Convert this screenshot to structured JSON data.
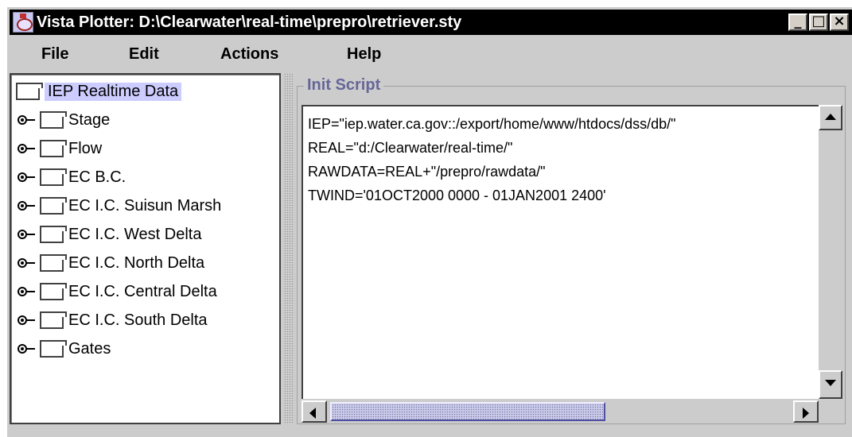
{
  "window": {
    "title": "Vista Plotter: D:\\Clearwater\\real-time\\prepro\\retriever.sty",
    "minimize_glyph": "_",
    "maximize_glyph": "□",
    "close_glyph": "×"
  },
  "menu": {
    "file": "File",
    "edit": "Edit",
    "actions": "Actions",
    "help": "Help"
  },
  "tree": {
    "root_label": "IEP Realtime Data",
    "items": [
      {
        "label": "Stage"
      },
      {
        "label": "Flow"
      },
      {
        "label": "EC B.C."
      },
      {
        "label": "EC I.C. Suisun Marsh"
      },
      {
        "label": "EC I.C. West Delta"
      },
      {
        "label": "EC I.C. North Delta"
      },
      {
        "label": "EC I.C. Central Delta"
      },
      {
        "label": "EC I.C. South Delta"
      },
      {
        "label": "Gates"
      }
    ]
  },
  "script_panel": {
    "title": "Init Script",
    "lines": [
      "IEP=\"iep.water.ca.gov::/export/home/www/htdocs/dss/db/\"",
      "REAL=\"d:/Clearwater/real-time/\"",
      "RAWDATA=REAL+\"/prepro/rawdata/\"",
      "TWIND='01OCT2000 0000 - 01JAN2001 2400'"
    ]
  },
  "colors": {
    "title_bar": "#000000",
    "chrome": "#cccccc",
    "selection": "#ccccff",
    "group_title": "#666699"
  }
}
